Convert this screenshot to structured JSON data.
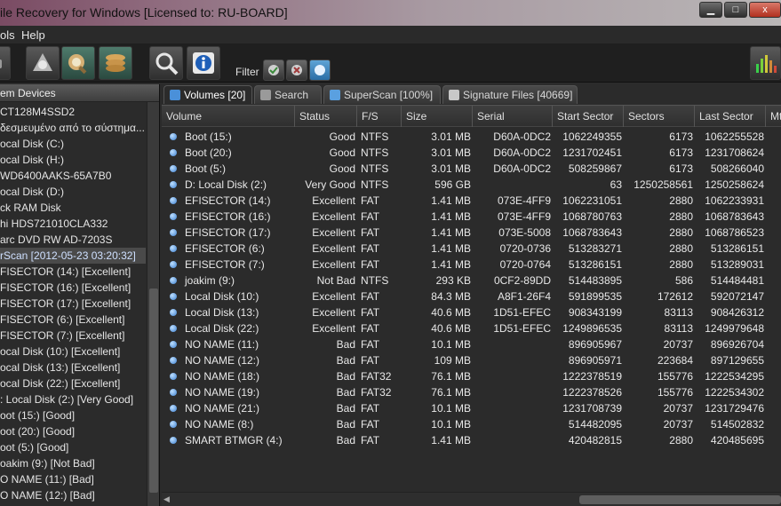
{
  "window": {
    "title": "ile Recovery for Windows [Licensed to: RU-BOARD]",
    "minimize_label": "▁",
    "maximize_label": "□",
    "close_label": "x"
  },
  "menu": {
    "items": [
      "ols",
      "Help"
    ]
  },
  "toolbar": {
    "filter_label": "Filter",
    "buttons": [
      "scan-icon",
      "recover-icon",
      "disks-icon",
      "search-icon",
      "info-icon"
    ]
  },
  "left_panel": {
    "header": "em Devices",
    "items": [
      "CT128M4SSD2",
      "δεσμευμένο από το σύστημα...",
      "ocal Disk (C:)",
      "ocal Disk (H:)",
      " WD6400AAKS-65A7B0",
      "ocal Disk (D:)",
      "ck  RAM Disk",
      "hi HDS721010CLA332",
      "arc DVD RW AD-7203S",
      "rScan [2012-05-23 03:20:32]",
      "FISECTOR (14:) [Excellent]",
      "FISECTOR (16:) [Excellent]",
      "FISECTOR (17:) [Excellent]",
      "FISECTOR (6:) [Excellent]",
      "FISECTOR (7:) [Excellent]",
      "ocal Disk (10:) [Excellent]",
      "ocal Disk (13:) [Excellent]",
      "ocal Disk (22:) [Excellent]",
      ": Local Disk (2:) [Very Good]",
      "oot (15:) [Good]",
      "oot (20:) [Good]",
      "oot (5:) [Good]",
      "oakim (9:) [Not Bad]",
      "O NAME (11:) [Bad]",
      "O NAME (12:) [Bad]"
    ],
    "selected_index": 9
  },
  "tabs": [
    {
      "label": "Volumes [20]",
      "active": true
    },
    {
      "label": "Search",
      "active": false
    },
    {
      "label": "SuperScan [100%]",
      "active": false
    },
    {
      "label": "Signature Files [40669]",
      "active": false
    }
  ],
  "table": {
    "columns": [
      "Volume",
      "Status",
      "F/S",
      "Size",
      "Serial",
      "Start Sector",
      "Sectors",
      "Last Sector",
      "Mt"
    ],
    "rows": [
      [
        "Boot (15:)",
        "Good",
        "NTFS",
        "3.01 MB",
        "D60A-0DC2",
        "1062249355",
        "6173",
        "1062255528"
      ],
      [
        "Boot (20:)",
        "Good",
        "NTFS",
        "3.01 MB",
        "D60A-0DC2",
        "1231702451",
        "6173",
        "1231708624"
      ],
      [
        "Boot (5:)",
        "Good",
        "NTFS",
        "3.01 MB",
        "D60A-0DC2",
        "508259867",
        "6173",
        "508266040"
      ],
      [
        "D: Local Disk (2:)",
        "Very Good",
        "NTFS",
        "596 GB",
        "",
        "63",
        "1250258561",
        "1250258624"
      ],
      [
        "EFISECTOR (14:)",
        "Excellent",
        "FAT",
        "1.41 MB",
        "073E-4FF9",
        "1062231051",
        "2880",
        "1062233931"
      ],
      [
        "EFISECTOR (16:)",
        "Excellent",
        "FAT",
        "1.41 MB",
        "073E-4FF9",
        "1068780763",
        "2880",
        "1068783643"
      ],
      [
        "EFISECTOR (17:)",
        "Excellent",
        "FAT",
        "1.41 MB",
        "073E-5008",
        "1068783643",
        "2880",
        "1068786523"
      ],
      [
        "EFISECTOR (6:)",
        "Excellent",
        "FAT",
        "1.41 MB",
        "0720-0736",
        "513283271",
        "2880",
        "513286151"
      ],
      [
        "EFISECTOR (7:)",
        "Excellent",
        "FAT",
        "1.41 MB",
        "0720-0764",
        "513286151",
        "2880",
        "513289031"
      ],
      [
        "joakim (9:)",
        "Not Bad",
        "NTFS",
        "293 KB",
        "0CF2-89DD",
        "514483895",
        "586",
        "514484481"
      ],
      [
        "Local Disk (10:)",
        "Excellent",
        "FAT",
        "84.3 MB",
        "A8F1-26F4",
        "591899535",
        "172612",
        "592072147"
      ],
      [
        "Local Disk (13:)",
        "Excellent",
        "FAT",
        "40.6 MB",
        "1D51-EFEC",
        "908343199",
        "83113",
        "908426312"
      ],
      [
        "Local Disk (22:)",
        "Excellent",
        "FAT",
        "40.6 MB",
        "1D51-EFEC",
        "1249896535",
        "83113",
        "1249979648"
      ],
      [
        "NO NAME (11:)",
        "Bad",
        "FAT",
        "10.1 MB",
        "",
        "896905967",
        "20737",
        "896926704"
      ],
      [
        "NO NAME (12:)",
        "Bad",
        "FAT",
        "109 MB",
        "",
        "896905971",
        "223684",
        "897129655"
      ],
      [
        "NO NAME (18:)",
        "Bad",
        "FAT32",
        "76.1 MB",
        "",
        "1222378519",
        "155776",
        "1222534295"
      ],
      [
        "NO NAME (19:)",
        "Bad",
        "FAT32",
        "76.1 MB",
        "",
        "1222378526",
        "155776",
        "1222534302"
      ],
      [
        "NO NAME (21:)",
        "Bad",
        "FAT",
        "10.1 MB",
        "",
        "1231708739",
        "20737",
        "1231729476"
      ],
      [
        "NO NAME (8:)",
        "Bad",
        "FAT",
        "10.1 MB",
        "",
        "514482095",
        "20737",
        "514502832"
      ],
      [
        "SMART BTMGR (4:)",
        "Bad",
        "FAT",
        "1.41 MB",
        "",
        "420482815",
        "2880",
        "420485695"
      ]
    ]
  },
  "colors": {
    "accent": "#4a90d9",
    "background": "#2b2b2b",
    "text": "#e8e8e8"
  }
}
